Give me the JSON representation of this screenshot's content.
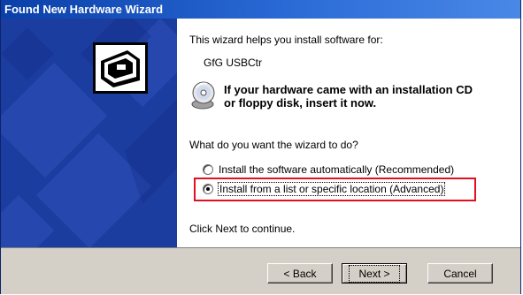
{
  "window": {
    "title": "Found New Hardware Wizard"
  },
  "content": {
    "intro": "This wizard helps you install software for:",
    "device_name": "GfG USBCtr",
    "cd_hint_line1": "If your hardware came with an installation CD",
    "cd_hint_line2": "or floppy disk, insert it now.",
    "question": "What do you want the wizard to do?",
    "options": [
      {
        "label": "Install the software automatically (Recommended)",
        "selected": false
      },
      {
        "label": "Install from a list or specific location (Advanced)",
        "selected": true
      }
    ],
    "continue_hint": "Click Next to continue."
  },
  "buttons": {
    "back": "< Back",
    "next": "Next >",
    "cancel": "Cancel"
  },
  "icons": {
    "side_panel": "hardware-wizard-icon",
    "cd": "cd-disk-icon"
  },
  "colors": {
    "titlebar": "#0a3fa8",
    "side_panel": "#1c3da0",
    "highlight": "#e01020",
    "button_face": "#d4d0c8"
  }
}
